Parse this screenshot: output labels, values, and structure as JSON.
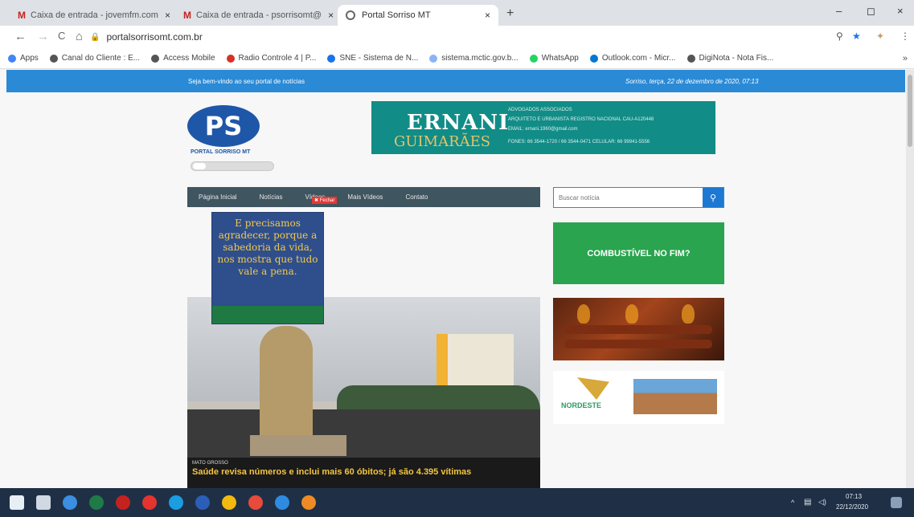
{
  "browser": {
    "tabs": [
      {
        "label": "Caixa de entrada - jovemfm.com",
        "icon": "gmail-icon",
        "active": false
      },
      {
        "label": "Caixa de entrada - psorrisomt@",
        "icon": "gmail-icon",
        "active": false
      },
      {
        "label": "Portal Sorriso MT",
        "icon": "globe-icon",
        "active": true
      }
    ],
    "tab_close_glyph": "×",
    "new_tab_glyph": "+",
    "gmail_glyph": "M",
    "url": "portalsorrisomt.com.br",
    "nav": {
      "back": "←",
      "forward": "→",
      "reload": "C",
      "home": "⌂"
    },
    "window": {
      "minimize": "–",
      "maximize": "◻",
      "close": "×"
    },
    "toolbar": {
      "zoom": "⚲",
      "star": "★",
      "extension": "✦",
      "menu": "⋮"
    },
    "bookmarks": [
      {
        "label": "Apps",
        "color": "#4285f4"
      },
      {
        "label": "Canal do Cliente : E...",
        "color": "#555555"
      },
      {
        "label": "Access Mobile",
        "color": "#555555"
      },
      {
        "label": "Radio Controle 4 | P...",
        "color": "#d93025"
      },
      {
        "label": "SNE - Sistema de N...",
        "color": "#1a73e8"
      },
      {
        "label": "sistema.mctic.gov.b...",
        "color": "#8ab4f8"
      },
      {
        "label": "WhatsApp",
        "color": "#25d366"
      },
      {
        "label": "Outlook.com - Micr...",
        "color": "#0078d4"
      },
      {
        "label": "DigiNota - Nota Fis...",
        "color": "#555555"
      }
    ],
    "bookmarks_more": "»"
  },
  "site": {
    "topbar": {
      "welcome": "Seja bem-vindo ao seu portal de notícias",
      "date": "Sorriso, terça, 22 de dezembro de 2020, 07:13"
    },
    "logo": {
      "mark": "PS",
      "text": "PORTAL SORRISO MT"
    },
    "banner": {
      "name_first": "ERNANI",
      "name_last": "GUIMARÃES",
      "line1": "ADVOGADOS ASSOCIADOS",
      "line2": "ARQUITETO E URBANISTA REGISTRO NACIONAL CAU-A120448",
      "line3": "EMAIL: ernani.1960@gmail.com",
      "line4": "FONES: 66 3544-1720 / 66 3544-0471   CELULAR: 66 99941-5556"
    },
    "menu": [
      "Página Inicial",
      "Notícias",
      "Vídeos",
      "Mais Vídeos",
      "Contato"
    ],
    "close_tag": "✖ Fechar",
    "search": {
      "placeholder": "Buscar notícia",
      "icon": "⚲"
    },
    "ad_message": "E precisamos agradecer, porque a sabedoria da vida, nos mostra que tudo vale a pena.",
    "hero": {
      "category": "MATO GROSSO",
      "headline": "Saúde revisa números e inclui mais 60 óbitos; já são 4.395 vítimas"
    },
    "sidebar_ads": {
      "fuel": "COMBUSTÍVEL NO FIM?",
      "nordeste": "NORDESTE"
    }
  },
  "taskbar": {
    "clock_time": "07:13",
    "clock_date": "22/12/2020",
    "apps": [
      {
        "name": "windows-start-icon",
        "color": "#e8eef5"
      },
      {
        "name": "task-view-icon",
        "color": "#cfd8e3"
      },
      {
        "name": "edge-icon",
        "color": "#3b8ee0"
      },
      {
        "name": "excel-icon",
        "color": "#1e7b45"
      },
      {
        "name": "mail-icon",
        "color": "#c5221f"
      },
      {
        "name": "opera-icon",
        "color": "#e3342f"
      },
      {
        "name": "edge-chromium-icon",
        "color": "#1b9de2"
      },
      {
        "name": "word-icon",
        "color": "#2b5eb8"
      },
      {
        "name": "file-explorer-icon",
        "color": "#f2b90f"
      },
      {
        "name": "chrome-icon",
        "color": "#e84a3c"
      },
      {
        "name": "network-app-icon",
        "color": "#2f8be0"
      },
      {
        "name": "orange-app-icon",
        "color": "#f08a24"
      }
    ],
    "tray": {
      "up": "^",
      "notifications": "▤",
      "sound": "◁)"
    }
  }
}
